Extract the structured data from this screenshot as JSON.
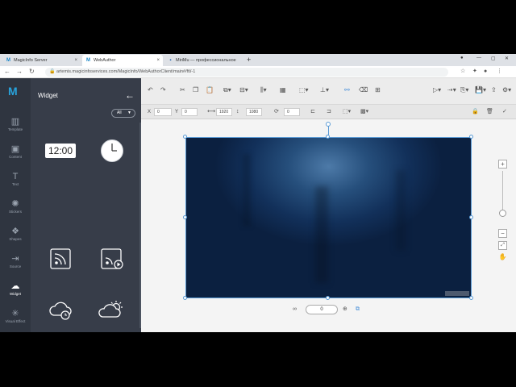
{
  "browser": {
    "tabs": [
      {
        "label": "MagicInfo Server",
        "icon": "M",
        "color": "#1a86c8"
      },
      {
        "label": "WebAuthor",
        "icon": "M",
        "color": "#1a86c8"
      },
      {
        "label": "MiriMu — профессиональное",
        "icon": "▪",
        "color": "#1a5fa8"
      }
    ],
    "new_tab": "+",
    "url": "artemis.magicinfoservices.com/MagicInfo/WebAuthorClient/main#/ftl/-1"
  },
  "rail": {
    "items": [
      {
        "label": "Template",
        "icon": "▥"
      },
      {
        "label": "Content",
        "icon": "▣"
      },
      {
        "label": "Text",
        "icon": "T"
      },
      {
        "label": "Stickers",
        "icon": "✺"
      },
      {
        "label": "Shapes",
        "icon": "❖"
      },
      {
        "label": "Source",
        "icon": "⇥"
      },
      {
        "label": "Widget",
        "icon": "☁"
      },
      {
        "label": "Visual Effect",
        "icon": "✳"
      }
    ]
  },
  "panel": {
    "title": "Widget",
    "filter": "All",
    "widgets": {
      "digital_clock": "12:00"
    }
  },
  "props": {
    "x_label": "X",
    "x_value": "0",
    "y_label": "Y",
    "y_value": "0",
    "width_value": "1920",
    "height_value": "1080",
    "rotation_value": "0"
  },
  "pager": {
    "page_value": "0"
  },
  "colors": {
    "rail_bg": "#2f3540",
    "panel_bg": "#373d49",
    "accent": "#28a3dc",
    "selection": "#5b9bd5"
  }
}
